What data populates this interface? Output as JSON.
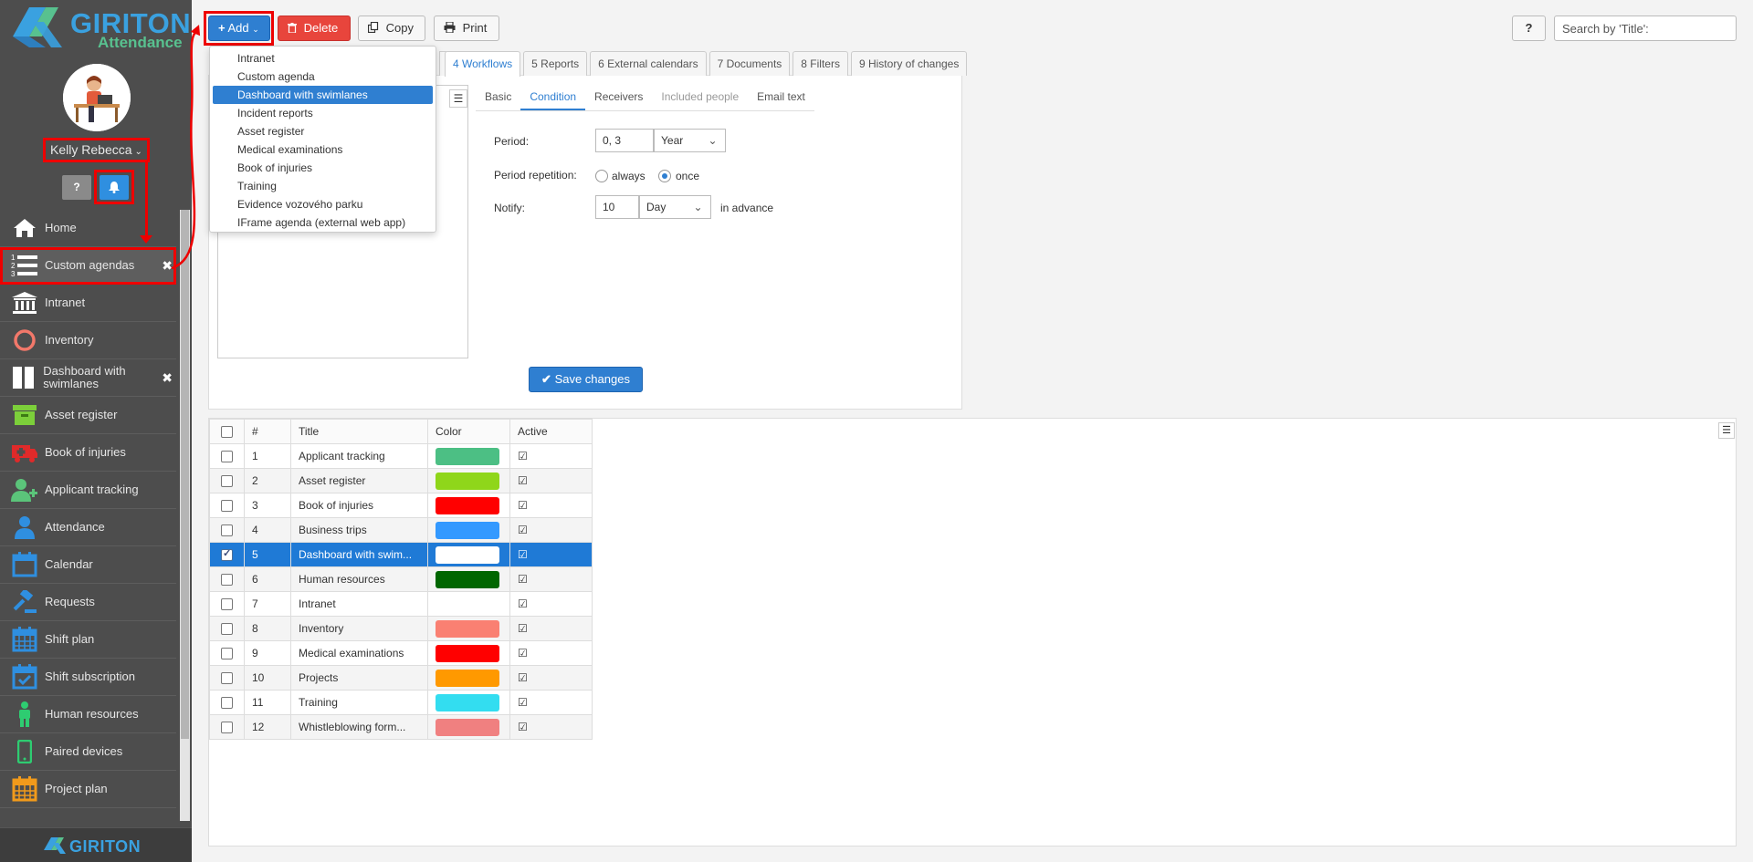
{
  "app": {
    "logo_title": "GIRITON",
    "logo_subtitle": "Attendance",
    "footer_logo": "GIRITON",
    "user_name": "Kelly Rebecca"
  },
  "sidebar": {
    "help_icon": "question-icon",
    "bell_icon": "bell-icon",
    "items": [
      {
        "label": "Home",
        "icon": "home-icon",
        "closable": false
      },
      {
        "label": "Custom agendas",
        "icon": "numbered-list-icon",
        "closable": true,
        "active": true
      },
      {
        "label": "Intranet",
        "icon": "building-icon",
        "closable": false
      },
      {
        "label": "Inventory",
        "icon": "circle-icon",
        "closable": false
      },
      {
        "label": "Dashboard with swimlanes",
        "icon": "columns-icon",
        "closable": true
      },
      {
        "label": "Asset register",
        "icon": "archive-box-icon",
        "closable": false
      },
      {
        "label": "Book of injuries",
        "icon": "ambulance-icon",
        "closable": false
      },
      {
        "label": "Applicant tracking",
        "icon": "user-plus-icon",
        "closable": false
      },
      {
        "label": "Attendance",
        "icon": "user-icon",
        "closable": false
      },
      {
        "label": "Calendar",
        "icon": "calendar-icon",
        "closable": false
      },
      {
        "label": "Requests",
        "icon": "gavel-icon",
        "closable": false
      },
      {
        "label": "Shift plan",
        "icon": "calendar-grid-icon",
        "closable": false
      },
      {
        "label": "Shift subscription",
        "icon": "calendar-check-icon",
        "closable": false
      },
      {
        "label": "Human resources",
        "icon": "person-icon",
        "closable": false
      },
      {
        "label": "Paired devices",
        "icon": "mobile-icon",
        "closable": false
      },
      {
        "label": "Project plan",
        "icon": "calendar-orange-icon",
        "closable": false
      }
    ]
  },
  "toolbar": {
    "add_label": "Add",
    "delete_label": "Delete",
    "copy_label": "Copy",
    "print_label": "Print",
    "help_label": "?",
    "search_placeholder": "Search by 'Title':"
  },
  "add_dropdown": {
    "items": [
      {
        "label": "Intranet"
      },
      {
        "label": "Custom agenda"
      },
      {
        "label": "Dashboard with swimlanes",
        "highlighted": true
      },
      {
        "label": "Incident reports"
      },
      {
        "label": "Asset register"
      },
      {
        "label": "Medical examinations"
      },
      {
        "label": "Book of injuries"
      },
      {
        "label": "Training"
      },
      {
        "label": "Evidence vozového parku"
      },
      {
        "label": "IFrame agenda (external web app)"
      }
    ]
  },
  "detail": {
    "tabs": [
      {
        "label": "4 Workflows",
        "active": true
      },
      {
        "label": "5 Reports"
      },
      {
        "label": "6 External calendars"
      },
      {
        "label": "7 Documents"
      },
      {
        "label": "8 Filters"
      },
      {
        "label": "9 History of changes"
      }
    ],
    "subtabs": [
      {
        "label": "Basic"
      },
      {
        "label": "Condition",
        "active": true
      },
      {
        "label": "Receivers"
      },
      {
        "label": "Included people",
        "disabled": true
      },
      {
        "label": "Email text"
      }
    ],
    "form": {
      "period_label": "Period:",
      "period_value": "0, 3",
      "period_unit": "Year",
      "repetition_label": "Period repetition:",
      "repetition_always": "always",
      "repetition_once": "once",
      "repetition_selected": "once",
      "notify_label": "Notify:",
      "notify_value": "10",
      "notify_unit": "Day",
      "notify_suffix": "in advance"
    },
    "save_label": "Save changes"
  },
  "grid": {
    "columns": [
      "#",
      "Title",
      "Color",
      "Active"
    ],
    "rows": [
      {
        "num": "1",
        "title": "Applicant tracking",
        "color": "#4cbf84",
        "active": true
      },
      {
        "num": "2",
        "title": "Asset register",
        "color": "#8fd61a",
        "active": true
      },
      {
        "num": "3",
        "title": "Book of injuries",
        "color": "#ff0000",
        "active": true
      },
      {
        "num": "4",
        "title": "Business trips",
        "color": "#3399ff",
        "active": true
      },
      {
        "num": "5",
        "title": "Dashboard with swim...",
        "color": "#ffffff",
        "active": true,
        "selected": true
      },
      {
        "num": "6",
        "title": "Human resources",
        "color": "#006600",
        "active": true
      },
      {
        "num": "7",
        "title": "Intranet",
        "color": "",
        "active": true
      },
      {
        "num": "8",
        "title": "Inventory",
        "color": "#fa8072",
        "active": true
      },
      {
        "num": "9",
        "title": "Medical examinations",
        "color": "#ff0000",
        "active": true
      },
      {
        "num": "10",
        "title": "Projects",
        "color": "#ff9900",
        "active": true
      },
      {
        "num": "11",
        "title": "Training",
        "color": "#33ddf0",
        "active": true
      },
      {
        "num": "12",
        "title": "Whistleblowing form...",
        "color": "#f08080",
        "active": true
      }
    ]
  }
}
